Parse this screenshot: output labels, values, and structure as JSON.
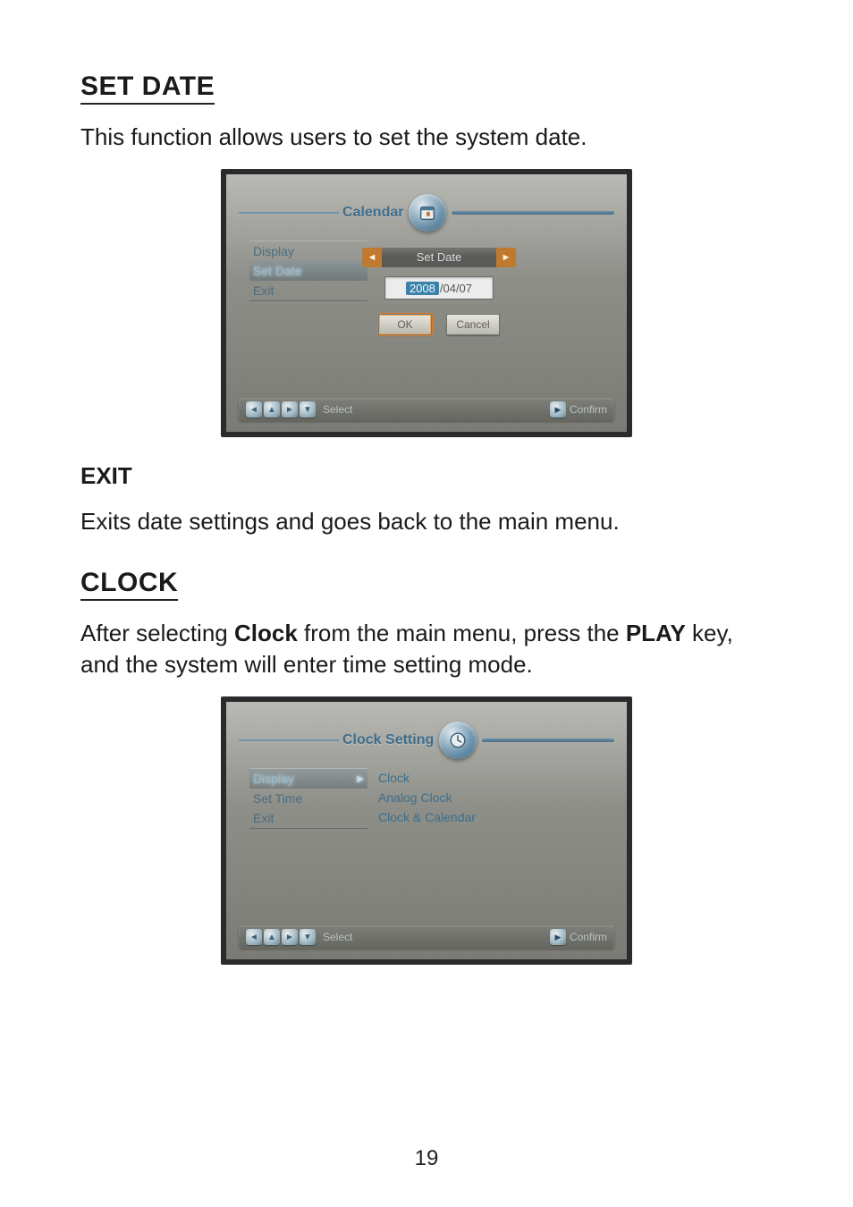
{
  "section1": {
    "title": "SET DATE",
    "body": "This function allows users to set the system date."
  },
  "exit": {
    "title": "EXIT",
    "body": "Exits date settings and goes back to the main menu."
  },
  "section2": {
    "title": "CLOCK",
    "body_pre": "After selecting ",
    "body_bold1": "Clock",
    "body_mid": " from the main menu, press the ",
    "body_bold2": "PLAY",
    "body_post": " key, and the system will enter time setting mode."
  },
  "page_number": "19",
  "shot1": {
    "header_title": "Calendar",
    "icon_name": "calendar-icon",
    "menu": {
      "items": [
        {
          "label": "Display",
          "highlight": false
        },
        {
          "label": "Set Date",
          "highlight": true
        },
        {
          "label": "Exit",
          "highlight": false
        }
      ]
    },
    "dialog": {
      "title": "Set Date",
      "date_year": "2008",
      "date_rest": "/04/07",
      "ok": "OK",
      "cancel": "Cancel"
    },
    "footer": {
      "select_label": "Select",
      "confirm_label": "Confirm"
    }
  },
  "shot2": {
    "header_title": "Clock Setting",
    "icon_name": "clock-icon",
    "menu": {
      "items": [
        {
          "label": "Display",
          "highlight": true,
          "chevron": true
        },
        {
          "label": "Set Time",
          "highlight": false
        },
        {
          "label": "Exit",
          "highlight": false
        }
      ]
    },
    "submenu": {
      "items": [
        {
          "label": "Clock"
        },
        {
          "label": "Analog Clock"
        },
        {
          "label": "Clock & Calendar"
        }
      ]
    },
    "footer": {
      "select_label": "Select",
      "confirm_label": "Confirm"
    }
  }
}
